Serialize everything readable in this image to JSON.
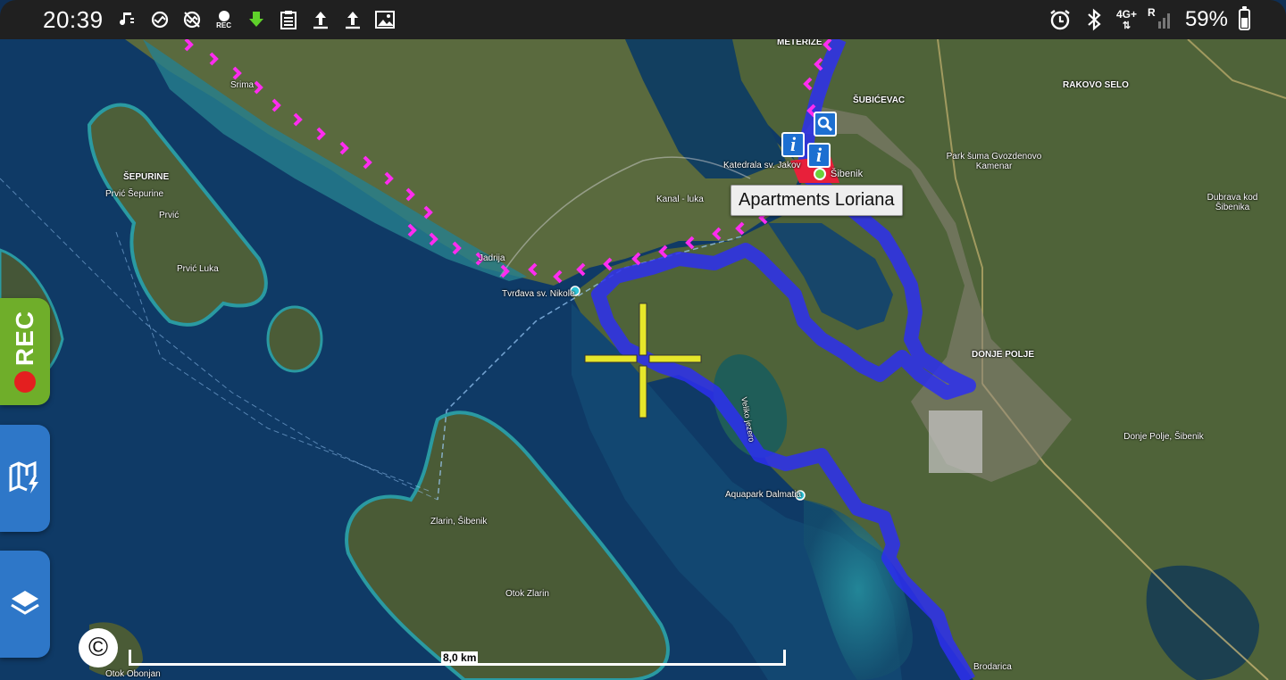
{
  "status_bar": {
    "time": "20:39",
    "left_icons": [
      "music-icon",
      "sync-icon",
      "sync-off-icon",
      "rec-indicator-icon",
      "download-arrow-icon",
      "clipboard-icon",
      "upload-icon",
      "upload-icon",
      "image-icon"
    ],
    "rec_small_label": "REC",
    "network_top": "4G+",
    "network_r": "R",
    "battery_percent": "59%"
  },
  "map": {
    "tooltip": "Apartments Loriana",
    "scale_label": "8,0 km",
    "copyright_symbol": "©",
    "place_labels": {
      "meterize": "METERIZE",
      "subicevac": "ŠUBIĆEVAC",
      "rakovo_selo": "RAKOVO SELO",
      "srima": "Srima",
      "sepurine": "ŠEPURINE",
      "prvic_sepurine": "Prvić Šepurine",
      "prvic": "Prvić",
      "prvic_luka": "Prvić Luka",
      "jadrija": "Jadrija",
      "tvrdava": "Tvrđava sv. Nikole",
      "katedrala": "Katedrala sv. Jakov",
      "sibenik": "Šibenik",
      "kanal": "Kanal - luka",
      "park_suma": "Park šuma Gvozdenovo Kamenar",
      "dubrava": "Dubrava kod Šibenika",
      "donje_polje": "DONJE POLJE",
      "donje_polje_sibenik": "Donje Polje, Šibenik",
      "aquapark": "Aquapark Dalmatia",
      "zlarin": "Zlarin, Šibenik",
      "otok_zlarin": "Otok Zlarin",
      "otok_obonjan": "Otok Obonjan",
      "brodarica": "Brodarica",
      "veliko_jezero": "Veliko jezero"
    }
  },
  "side_buttons": {
    "rec_label": "REC",
    "map_icon": "map-lightning-icon",
    "layers_icon": "layers-icon"
  },
  "colors": {
    "route_blue": "#2d2ff0",
    "track_magenta": "#ff2cf0",
    "crosshair": "#e6e62a",
    "rec_green": "#6fae2a",
    "button_blue": "#2e77c8",
    "pin_blue": "#1d6fd1",
    "target_red": "#e8203a"
  }
}
